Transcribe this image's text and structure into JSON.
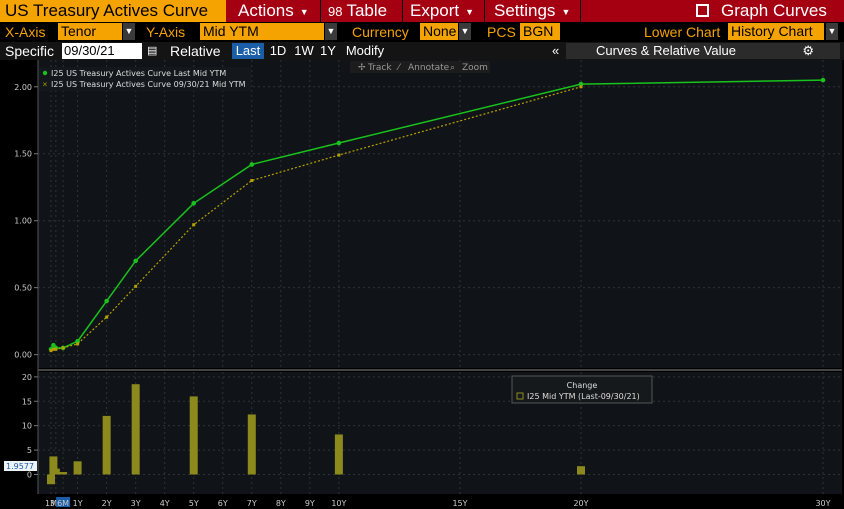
{
  "toolbar": {
    "title": "US Treasury Actives Curve",
    "actions": "Actions",
    "table_num": "98",
    "table": "Table",
    "export": "Export",
    "settings": "Settings",
    "graph_curves": "Graph Curves"
  },
  "axes_bar": {
    "xaxis_label": "X-Axis",
    "xaxis_value": "Tenor",
    "yaxis_label": "Y-Axis",
    "yaxis_value": "Mid YTM",
    "currency_label": "Currency",
    "currency_value": "None",
    "pcs_label": "PCS",
    "pcs_value": "BGN",
    "lower_chart_label": "Lower Chart",
    "lower_chart_value": "History Chart"
  },
  "date_bar": {
    "specific_label": "Specific",
    "date_value": "09/30/21",
    "relative_label": "Relative",
    "buttons": [
      "Last",
      "1D",
      "1W",
      "1Y",
      "Modify"
    ],
    "panel_label": "Curves & Relative Value"
  },
  "chart_tools": {
    "track": "Track",
    "annotate": "Annotate",
    "zoom": "Zoom"
  },
  "colors": {
    "last_series": "#19c21c",
    "prior_series": "#b8a200",
    "bar": "#8c8a1c",
    "accent": "#f5a300",
    "header": "#a50012"
  },
  "chart_data": [
    {
      "type": "line",
      "x": [
        "1M",
        "2M",
        "3M",
        "6M",
        "1Y",
        "2Y",
        "3Y",
        "5Y",
        "7Y",
        "10Y",
        "20Y",
        "30Y"
      ],
      "series": [
        {
          "name": "I25 US Treasury Actives Curve Last Mid YTM",
          "values": [
            0.04,
            0.07,
            0.05,
            0.05,
            0.1,
            0.4,
            0.7,
            1.13,
            1.42,
            1.58,
            2.02,
            2.05
          ]
        },
        {
          "name": "I25 US Treasury Actives Curve 09/30/21 Mid YTM",
          "values": [
            0.03,
            0.04,
            0.04,
            0.05,
            0.08,
            0.28,
            0.51,
            0.97,
            1.3,
            1.49,
            2.0,
            null
          ]
        }
      ],
      "yticks": [
        "0.00",
        "0.50",
        "1.00",
        "1.50",
        "2.00"
      ],
      "ylim": [
        -0.1,
        2.2
      ],
      "grid": true,
      "legend": "top-left"
    },
    {
      "type": "bar",
      "title": "Change",
      "legend_entry": "I25 Mid YTM (Last-09/30/21)",
      "x": [
        "1M",
        "2M",
        "3M",
        "6M",
        "1Y",
        "2Y",
        "3Y",
        "5Y",
        "7Y",
        "10Y",
        "20Y"
      ],
      "values": [
        -2,
        3.7,
        1.2,
        0.5,
        2.7,
        12,
        18.5,
        16,
        12.3,
        8.2,
        1.7
      ],
      "yticks": [
        "0",
        "5",
        "10",
        "15",
        "20"
      ],
      "ylim": [
        -4,
        21
      ],
      "cursor_value": "1.9577",
      "xtick_labels": [
        "1M",
        "3M",
        "6M",
        "1Y",
        "2Y",
        "3Y",
        "4Y",
        "5Y",
        "6Y",
        "7Y",
        "8Y",
        "9Y",
        "10Y",
        "15Y",
        "20Y",
        "30Y"
      ]
    }
  ]
}
